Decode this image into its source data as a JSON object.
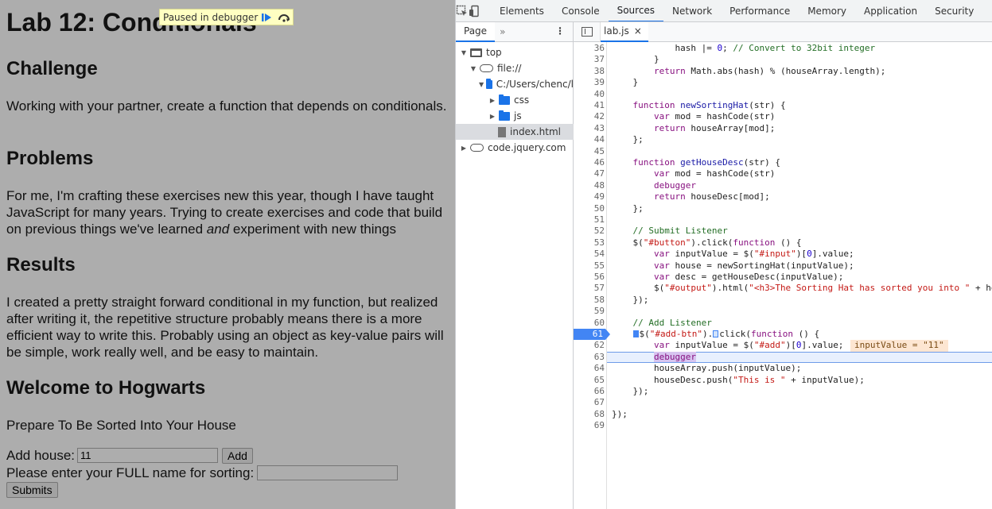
{
  "page": {
    "title": "Lab 12: Conditionals",
    "sections": [
      {
        "heading": "Challenge",
        "text": "Working with your partner, create a function that depends on conditionals."
      },
      {
        "heading": "Problems",
        "text_before": "For me, I'm crafting these exercises new this year, though I have taught JavaScript for many years. Trying to create exercises and code that build on previous things we've learned ",
        "text_em": "and",
        "text_after": " experiment with new things"
      },
      {
        "heading": "Results",
        "text": "I created a pretty straight forward conditional in my function, but realized after writing it, the repetitive structure probably means there is a more efficient way to write this. Probably using an object as key-value pairs will be simple, work really well, and be easy to maintain."
      },
      {
        "heading": "Welcome to Hogwarts",
        "text": "Prepare To Be Sorted Into Your House"
      }
    ],
    "add_house_label": "Add house:",
    "add_house_value": "11",
    "add_button": "Add",
    "name_label": "Please enter your FULL name for sorting:",
    "name_value": "",
    "submit_button": "Submits"
  },
  "paused_banner": {
    "text": "Paused in debugger"
  },
  "devtools": {
    "tabs": [
      "Elements",
      "Console",
      "Sources",
      "Network",
      "Performance",
      "Memory",
      "Application",
      "Security",
      "L"
    ],
    "active_tab": "Sources",
    "navigator": {
      "tab": "Page",
      "more": "»",
      "tree": [
        {
          "label": "top",
          "indent": 0,
          "arrow": "▼",
          "icon": "frame"
        },
        {
          "label": "file://",
          "indent": 1,
          "arrow": "▼",
          "icon": "cloud"
        },
        {
          "label": "C:/Users/chenc/l",
          "indent": 2,
          "arrow": "▼",
          "icon": "folder"
        },
        {
          "label": "css",
          "indent": 3,
          "arrow": "▶",
          "icon": "folder"
        },
        {
          "label": "js",
          "indent": 3,
          "arrow": "▶",
          "icon": "folder"
        },
        {
          "label": "index.html",
          "indent": 3,
          "arrow": "",
          "icon": "file",
          "selected": true
        },
        {
          "label": "code.jquery.com",
          "indent": 0,
          "arrow": "▶",
          "icon": "cloud"
        }
      ]
    },
    "editor": {
      "file_tab": "lab.js",
      "close": "×",
      "breakpoint_line": 61,
      "current_line": 63,
      "inline_value": "inputValue = \"11\"",
      "lines": [
        {
          "n": 36,
          "html": "            hash |= <span class=\"num\">0</span>; <span class=\"cm\">// Convert to 32bit integer</span>"
        },
        {
          "n": 37,
          "html": "        }"
        },
        {
          "n": 38,
          "html": "        <span class=\"kw\">return</span> Math.abs(hash) % (houseArray.length);"
        },
        {
          "n": 39,
          "html": "    }"
        },
        {
          "n": 40,
          "html": ""
        },
        {
          "n": 41,
          "html": "    <span class=\"kw\">function</span> <span class=\"fn\">newSortingHat</span>(str) {"
        },
        {
          "n": 42,
          "html": "        <span class=\"kw\">var</span> mod = hashCode(str)"
        },
        {
          "n": 43,
          "html": "        <span class=\"kw\">return</span> houseArray[mod];"
        },
        {
          "n": 44,
          "html": "    };"
        },
        {
          "n": 45,
          "html": ""
        },
        {
          "n": 46,
          "html": "    <span class=\"kw\">function</span> <span class=\"fn\">getHouseDesc</span>(str) {"
        },
        {
          "n": 47,
          "html": "        <span class=\"kw\">var</span> mod = hashCode(str)"
        },
        {
          "n": 48,
          "html": "        <span class=\"kw\">debugger</span>"
        },
        {
          "n": 49,
          "html": "        <span class=\"kw\">return</span> houseDesc[mod];"
        },
        {
          "n": 50,
          "html": "    };"
        },
        {
          "n": 51,
          "html": ""
        },
        {
          "n": 52,
          "html": "    <span class=\"cm\">// Submit Listener</span>"
        },
        {
          "n": 53,
          "html": "    $(<span class=\"str\">\"#button\"</span>).click(<span class=\"kw\">function</span> () {"
        },
        {
          "n": 54,
          "html": "        <span class=\"kw\">var</span> inputValue = $(<span class=\"str\">\"#input\"</span>)[<span class=\"num\">0</span>].value;"
        },
        {
          "n": 55,
          "html": "        <span class=\"kw\">var</span> house = newSortingHat(inputValue);"
        },
        {
          "n": 56,
          "html": "        <span class=\"kw\">var</span> desc = getHouseDesc(inputValue);"
        },
        {
          "n": 57,
          "html": "        $(<span class=\"str\">\"#output\"</span>).html(<span class=\"str\">\"&lt;h3&gt;The Sorting Hat has sorted you into \"</span> + ho"
        },
        {
          "n": 58,
          "html": "    });"
        },
        {
          "n": 59,
          "html": ""
        },
        {
          "n": 60,
          "html": "    <span class=\"cm\">// Add Listener</span>"
        },
        {
          "n": 61,
          "html": "    <span class=\"bpm\"></span>$(<span class=\"str\">\"#add-btn\"</span>).<span class=\"bpm2\"></span>click(<span class=\"kw\">function</span> () {"
        },
        {
          "n": 62,
          "html": "        <span class=\"kw\">var</span> inputValue = $(<span class=\"str\">\"#add\"</span>)[<span class=\"num\">0</span>].value;"
        },
        {
          "n": 63,
          "html": "        <span class=\"dbg\">debugger</span>"
        },
        {
          "n": 64,
          "html": "        houseArray.push(inputValue);"
        },
        {
          "n": 65,
          "html": "        houseDesc.push(<span class=\"str\">\"This is \"</span> + inputValue);"
        },
        {
          "n": 66,
          "html": "    });"
        },
        {
          "n": 67,
          "html": ""
        },
        {
          "n": 68,
          "html": "});"
        },
        {
          "n": 69,
          "html": ""
        }
      ]
    }
  }
}
